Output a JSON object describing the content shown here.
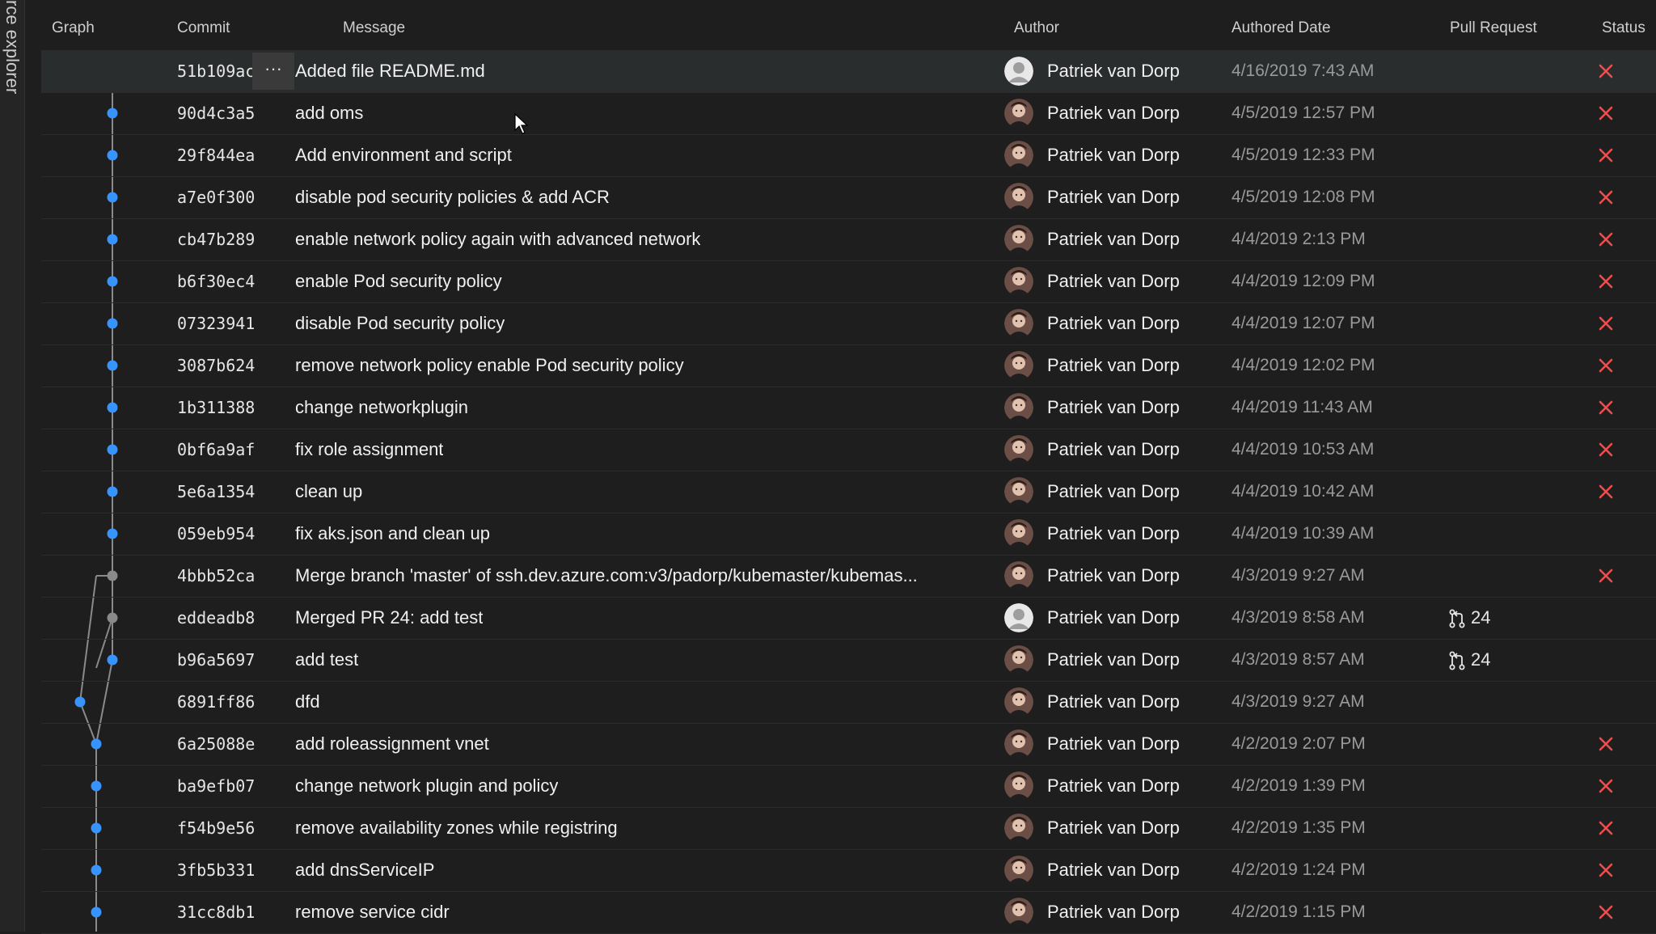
{
  "sidebar": {
    "vertical_label": "rce explorer"
  },
  "columns": {
    "graph": "Graph",
    "commit": "Commit",
    "message": "Message",
    "author": "Author",
    "date": "Authored Date",
    "pr": "Pull Request",
    "status": "Status"
  },
  "more_label": "···",
  "colors": {
    "accent": "#3794ff",
    "error": "#f14c4c",
    "merge_node": "#8a8a8a"
  },
  "commits": [
    {
      "hash": "51b109ac",
      "message": "Added file README.md",
      "author": "Patriek van Dorp",
      "date": "4/16/2019 7:43 AM",
      "pr": "",
      "status": "failed",
      "avatar": "default"
    },
    {
      "hash": "90d4c3a5",
      "message": "add oms",
      "author": "Patriek van Dorp",
      "date": "4/5/2019 12:57 PM",
      "pr": "",
      "status": "failed",
      "avatar": "photo"
    },
    {
      "hash": "29f844ea",
      "message": "Add environment and script",
      "author": "Patriek van Dorp",
      "date": "4/5/2019 12:33 PM",
      "pr": "",
      "status": "failed",
      "avatar": "photo"
    },
    {
      "hash": "a7e0f300",
      "message": "disable pod security policies & add ACR",
      "author": "Patriek van Dorp",
      "date": "4/5/2019 12:08 PM",
      "pr": "",
      "status": "failed",
      "avatar": "photo"
    },
    {
      "hash": "cb47b289",
      "message": "enable network policy again with advanced network",
      "author": "Patriek van Dorp",
      "date": "4/4/2019 2:13 PM",
      "pr": "",
      "status": "failed",
      "avatar": "photo"
    },
    {
      "hash": "b6f30ec4",
      "message": "enable Pod security policy",
      "author": "Patriek van Dorp",
      "date": "4/4/2019 12:09 PM",
      "pr": "",
      "status": "failed",
      "avatar": "photo"
    },
    {
      "hash": "07323941",
      "message": "disable Pod security policy",
      "author": "Patriek van Dorp",
      "date": "4/4/2019 12:07 PM",
      "pr": "",
      "status": "failed",
      "avatar": "photo"
    },
    {
      "hash": "3087b624",
      "message": "remove network policy enable Pod security policy",
      "author": "Patriek van Dorp",
      "date": "4/4/2019 12:02 PM",
      "pr": "",
      "status": "failed",
      "avatar": "photo"
    },
    {
      "hash": "1b311388",
      "message": "change networkplugin",
      "author": "Patriek van Dorp",
      "date": "4/4/2019 11:43 AM",
      "pr": "",
      "status": "failed",
      "avatar": "photo"
    },
    {
      "hash": "0bf6a9af",
      "message": "fix role assignment",
      "author": "Patriek van Dorp",
      "date": "4/4/2019 10:53 AM",
      "pr": "",
      "status": "failed",
      "avatar": "photo"
    },
    {
      "hash": "5e6a1354",
      "message": "clean up",
      "author": "Patriek van Dorp",
      "date": "4/4/2019 10:42 AM",
      "pr": "",
      "status": "failed",
      "avatar": "photo"
    },
    {
      "hash": "059eb954",
      "message": "fix aks.json and clean up",
      "author": "Patriek van Dorp",
      "date": "4/4/2019 10:39 AM",
      "pr": "",
      "status": "",
      "avatar": "photo"
    },
    {
      "hash": "4bbb52ca",
      "message": "Merge branch 'master' of ssh.dev.azure.com:v3/padorp/kubemaster/kubemas...",
      "author": "Patriek van Dorp",
      "date": "4/3/2019 9:27 AM",
      "pr": "",
      "status": "failed",
      "avatar": "photo"
    },
    {
      "hash": "eddeadb8",
      "message": "Merged PR 24: add test",
      "author": "Patriek van Dorp",
      "date": "4/3/2019 8:58 AM",
      "pr": "24",
      "status": "",
      "avatar": "default"
    },
    {
      "hash": "b96a5697",
      "message": "add test",
      "author": "Patriek van Dorp",
      "date": "4/3/2019 8:57 AM",
      "pr": "24",
      "status": "",
      "avatar": "photo"
    },
    {
      "hash": "6891ff86",
      "message": "dfd",
      "author": "Patriek van Dorp",
      "date": "4/3/2019 9:27 AM",
      "pr": "",
      "status": "",
      "avatar": "photo"
    },
    {
      "hash": "6a25088e",
      "message": "add roleassignment vnet",
      "author": "Patriek van Dorp",
      "date": "4/2/2019 2:07 PM",
      "pr": "",
      "status": "failed",
      "avatar": "photo"
    },
    {
      "hash": "ba9efb07",
      "message": "change network plugin and policy",
      "author": "Patriek van Dorp",
      "date": "4/2/2019 1:39 PM",
      "pr": "",
      "status": "failed",
      "avatar": "photo"
    },
    {
      "hash": "f54b9e56",
      "message": "remove availability zones while registring",
      "author": "Patriek van Dorp",
      "date": "4/2/2019 1:35 PM",
      "pr": "",
      "status": "failed",
      "avatar": "photo"
    },
    {
      "hash": "3fb5b331",
      "message": "add dnsServiceIP",
      "author": "Patriek van Dorp",
      "date": "4/2/2019 1:24 PM",
      "pr": "",
      "status": "failed",
      "avatar": "photo"
    },
    {
      "hash": "31cc8db1",
      "message": "remove service cidr",
      "author": "Patriek van Dorp",
      "date": "4/2/2019 1:15 PM",
      "pr": "",
      "status": "failed",
      "avatar": "photo"
    }
  ]
}
